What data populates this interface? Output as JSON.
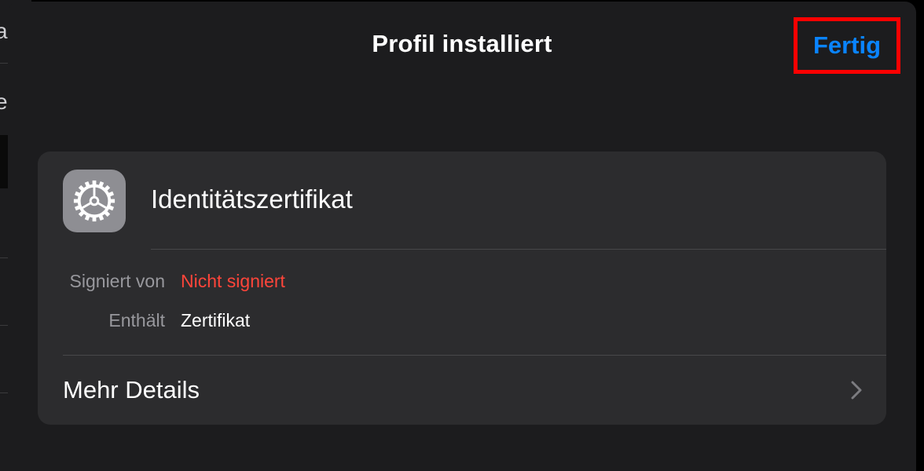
{
  "background": {
    "fragment_top": "a",
    "fragment_mid": "e"
  },
  "header": {
    "title": "Profil installiert",
    "done_label": "Fertig"
  },
  "profile": {
    "icon": "settings-gear-icon",
    "name": "Identitätszertifikat",
    "rows": [
      {
        "label": "Signiert von",
        "value": "Nicht signiert",
        "value_color": "#ff453a"
      },
      {
        "label": "Enthält",
        "value": "Zertifikat",
        "value_color": "#ffffff"
      }
    ],
    "more_details_label": "Mehr Details"
  },
  "colors": {
    "accent": "#0a84ff",
    "warning": "#ff453a",
    "highlight_box": "#ff0000"
  }
}
